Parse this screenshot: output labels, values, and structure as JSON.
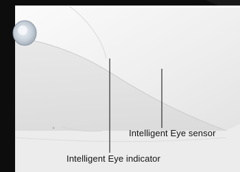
{
  "callouts": {
    "sensor_label": "Intelligent Eye sensor",
    "indicator_label": "Intelligent Eye indicator"
  },
  "colors": {
    "frame": "#0d0d0d",
    "panel": "#f4f4f4",
    "lens_ring": "#c9d2db",
    "line": "#2a2a2a"
  }
}
